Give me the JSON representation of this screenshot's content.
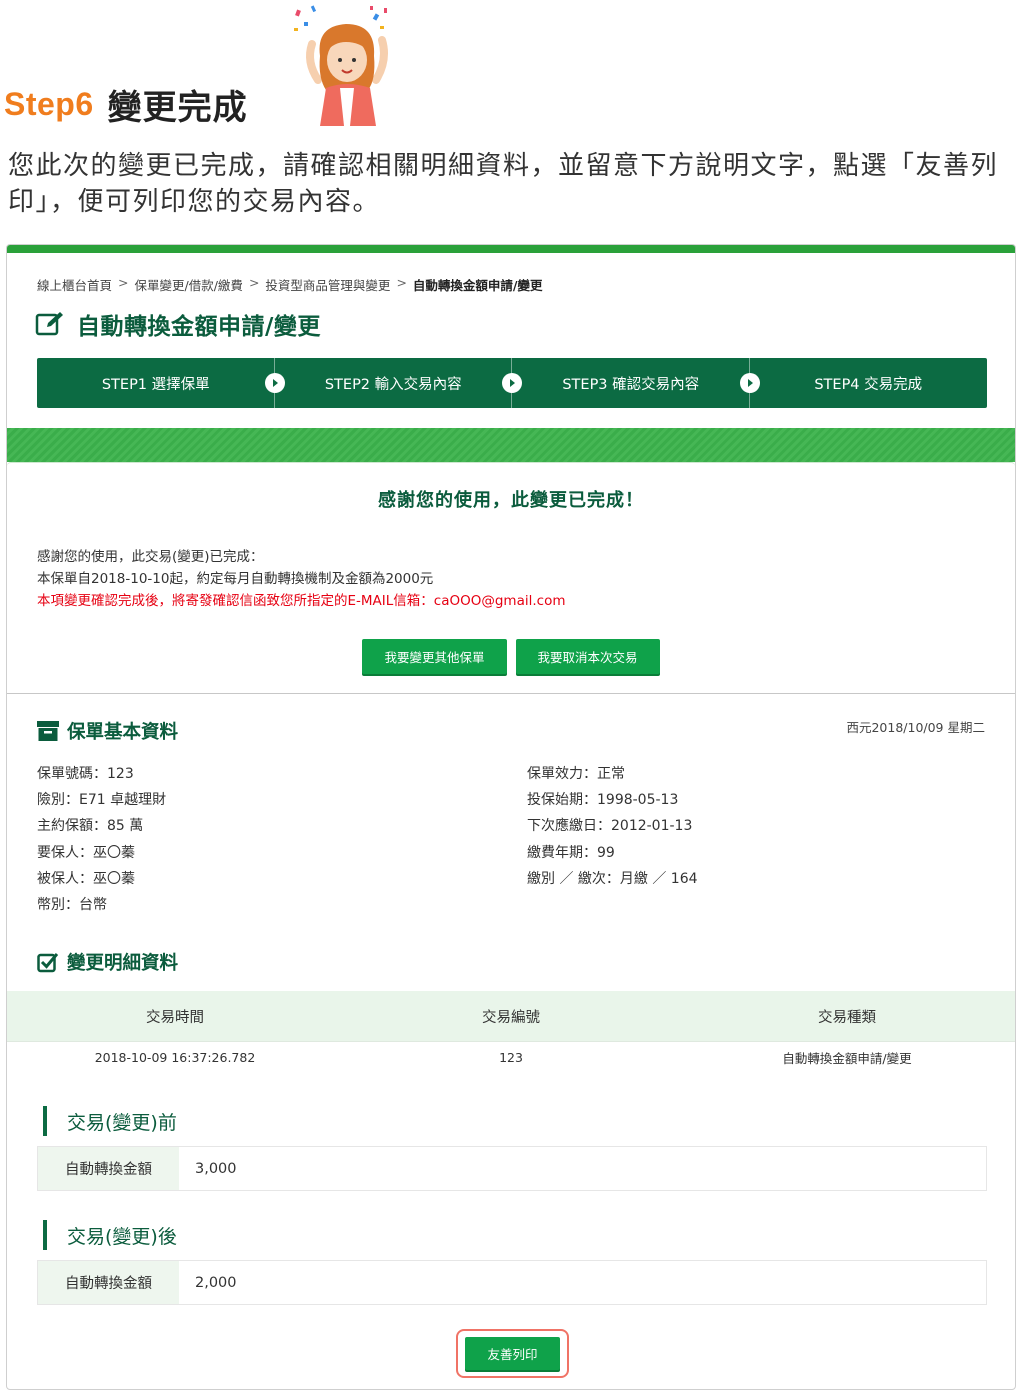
{
  "header": {
    "step_num": "Step6",
    "step_name": "變更完成",
    "instructions": "您此次的變更已完成，請確認相關明細資料，並留意下方說明文字，點選「友善列印」，便可列印您的交易內容。"
  },
  "breadcrumb": {
    "items": [
      "線上櫃台首頁",
      "保單變更/借款/繳費",
      "投資型商品管理與變更"
    ],
    "current": "自動轉換金額申請/變更",
    "separator": ">"
  },
  "page": {
    "title": "自動轉換金額申請/變更",
    "title_icon": "edit-icon"
  },
  "stepper": {
    "steps": [
      "STEP1 選擇保單",
      "STEP2 輸入交易內容",
      "STEP3 確認交易內容",
      "STEP4 交易完成"
    ]
  },
  "thanks": {
    "title": "感謝您的使用，此變更已完成！",
    "line1": "感謝您的使用，此交易(變更)已完成：",
    "line2": "本保單自2018-10-10起，約定每月自動轉換機制及金額為2000元",
    "warning": "本項變更確認完成後，將寄發確認信函致您所指定的E-MAIL信箱：caOOO@gmail.com",
    "btn_other_policy": "我要變更其他保單",
    "btn_cancel_tx": "我要取消本次交易"
  },
  "policy": {
    "section_title": "保單基本資料",
    "date": "西元2018/10/09 星期二",
    "left": [
      "保單號碼：123",
      "險別：E71 卓越理財",
      "主約保額：85 萬",
      "要保人：巫〇蓁",
      "被保人：巫〇蓁",
      "幣別：台幣"
    ],
    "right": [
      "保單效力：正常",
      "投保始期：1998-05-13",
      "下次應繳日：2012-01-13",
      "繳費年期：99",
      "繳別 ／ 繳次：月繳 ／ 164"
    ]
  },
  "change_detail": {
    "section_title": "變更明細資料",
    "columns": [
      "交易時間",
      "交易編號",
      "交易種類"
    ],
    "rows": [
      [
        "2018-10-09 16:37:26.782",
        "123",
        "自動轉換金額申請/變更"
      ]
    ]
  },
  "before": {
    "title": "交易(變更)前",
    "label": "自動轉換金額",
    "value": "3,000"
  },
  "after": {
    "title": "交易(變更)後",
    "label": "自動轉換金額",
    "value": "2,000"
  },
  "actions": {
    "print_label": "友善列印"
  },
  "colors": {
    "accent_orange": "#f07d1e",
    "dark_green": "#0c6b43",
    "button_green": "#0fa24a",
    "warning_red": "#e60012",
    "highlight_border": "#f07366"
  }
}
